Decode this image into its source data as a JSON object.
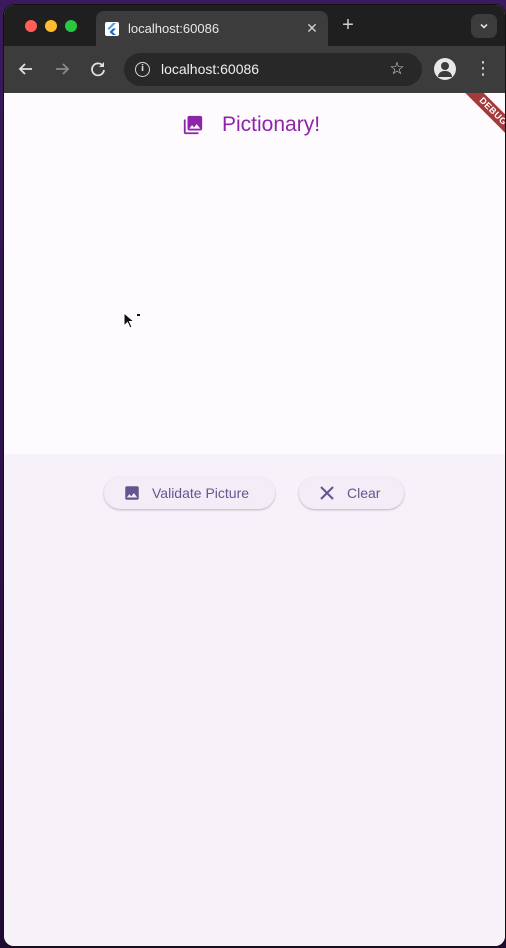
{
  "browser": {
    "tab_title": "localhost:60086",
    "tab_close_glyph": "✕",
    "new_tab_glyph": "+",
    "tab_search_glyph": "⌄",
    "url": "localhost:60086",
    "icons": {
      "back": "arrow-left-icon",
      "forward": "arrow-right-icon",
      "reload": "reload-icon",
      "site_info": "info-icon",
      "bookmark": "star-icon",
      "profile": "profile-icon",
      "menu": "kebab-menu-icon"
    }
  },
  "app": {
    "title": "Pictionary!",
    "title_icon": "photo-library-icon",
    "debug_banner": "DEBUG",
    "buttons": {
      "validate_label": "Validate Picture",
      "validate_icon": "image-icon",
      "clear_label": "Clear",
      "clear_icon": "close-icon"
    },
    "colors": {
      "accent": "#8e24aa",
      "button_text": "#65558f",
      "button_bg": "#f3edf7",
      "canvas_bg": "#fefbff",
      "page_bg": "#f7f1fa",
      "debug_ribbon": "#a53a3a"
    }
  }
}
